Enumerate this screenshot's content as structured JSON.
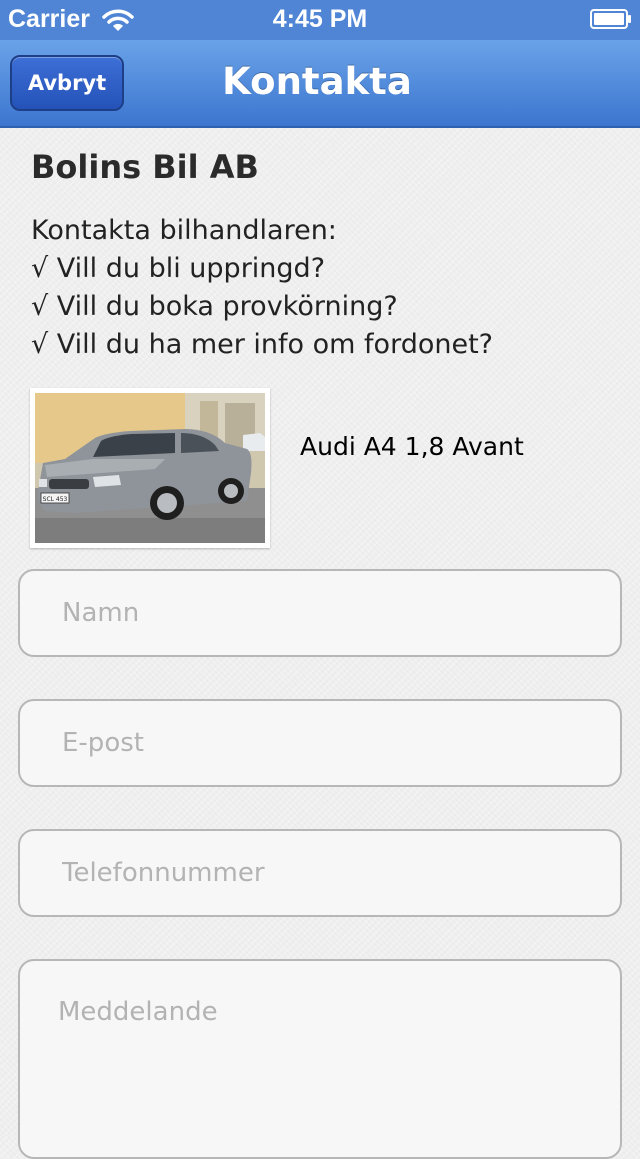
{
  "status_bar": {
    "carrier": "Carrier",
    "time": "4:45 PM",
    "wifi_icon": "wifi-icon",
    "battery_icon": "battery-icon"
  },
  "nav": {
    "cancel_label": "Avbryt",
    "title": "Kontakta"
  },
  "dealer": {
    "name": "Bolins Bil AB"
  },
  "contact_info": {
    "lines": [
      "Kontakta bilhandlaren:",
      "√ Vill du bli uppringd?",
      "√ Vill du boka provkörning?",
      "√ Vill du ha mer info om fordonet?"
    ]
  },
  "car": {
    "name": "Audi A4 1,8 Avant",
    "plate_text": "SCL 453"
  },
  "form": {
    "name_placeholder": "Namn",
    "email_placeholder": "E-post",
    "phone_placeholder": "Telefonnummer",
    "message_placeholder": "Meddelande"
  },
  "colors": {
    "nav_blue": "#4f85d4",
    "button_blue": "#2452b8",
    "background": "#efefef"
  }
}
